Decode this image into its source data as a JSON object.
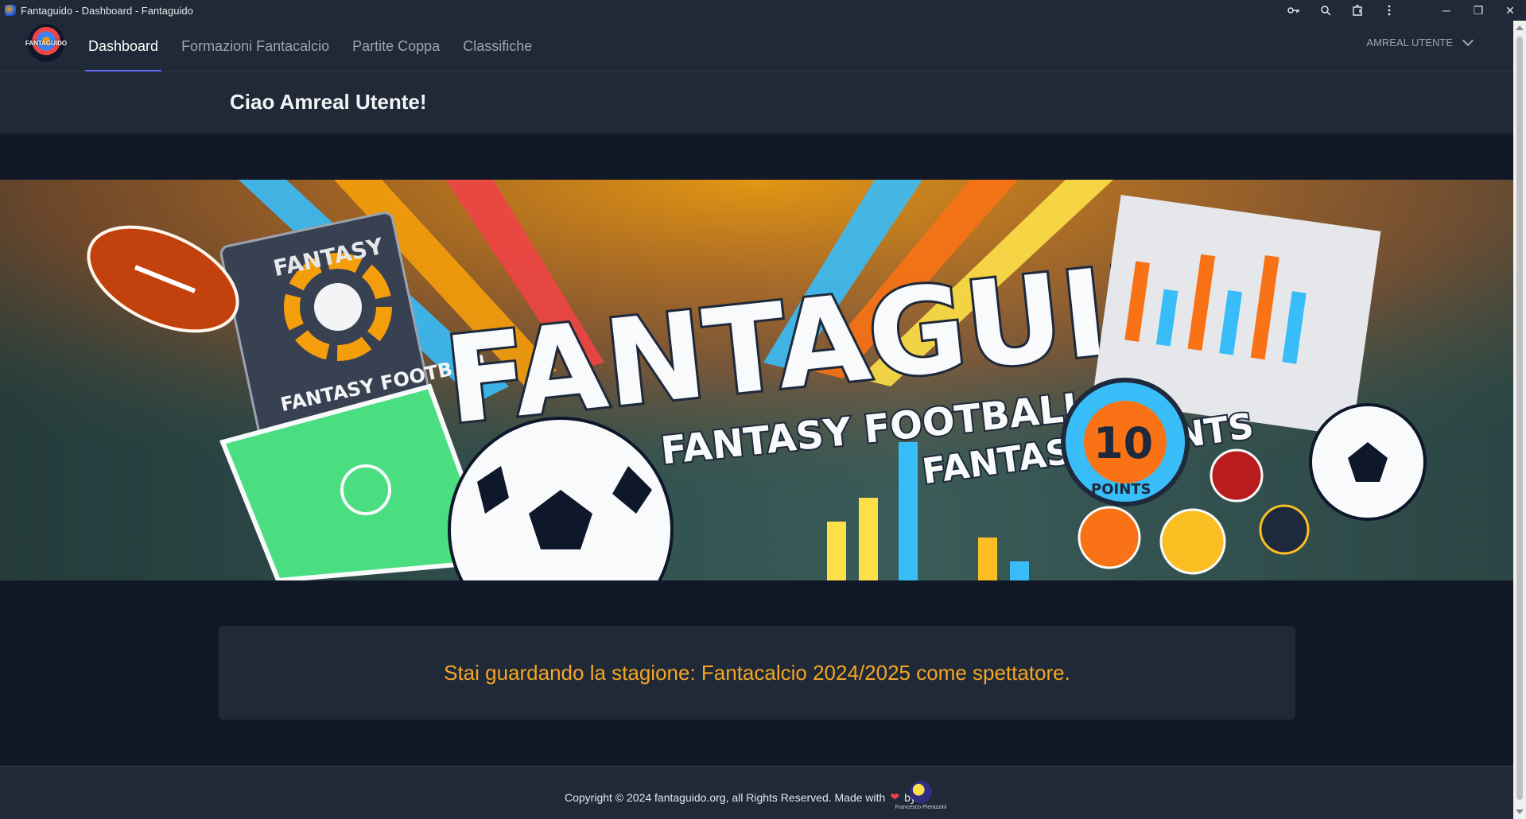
{
  "window": {
    "title": "Fantaguido - Dashboard - Fantaguido"
  },
  "toolbar_icons": [
    "key-icon",
    "zoom-icon",
    "extensions-icon",
    "menu-icon"
  ],
  "window_controls": {
    "minimize": "─",
    "restore": "❐",
    "close": "✕"
  },
  "navbar": {
    "logo_text": "FANTAGUIDO",
    "links": [
      {
        "label": "Dashboard",
        "active": true
      },
      {
        "label": "Formazioni Fantacalcio",
        "active": false
      },
      {
        "label": "Partite Coppa",
        "active": false
      },
      {
        "label": "Classifiche",
        "active": false
      }
    ],
    "user_label": "AMREAL UTENTE"
  },
  "greeting": "Ciao Amreal Utente!",
  "banner": {
    "title": "FANTAGUIDO",
    "subtitle": "FANTASY FOOTBALL",
    "badge_left_top": "FANTASY",
    "badge_left_bottom": "FANTASY FOOTBALL",
    "points_label": "FANTASY POINTS",
    "points_value": "10",
    "points_ring": "POINTS"
  },
  "season_message": "Stai guardando la stagione: Fantacalcio 2024/2025 come spettatore.",
  "footer": {
    "copyright": "Copyright © 2024 fantaguido.org, all Rights Reserved. Made with",
    "by": "by",
    "signature": "Francesco Pierazzini"
  },
  "colors": {
    "background": "#111827",
    "surface": "#1f2937",
    "accent": "#6366f1",
    "season_text": "#f5a623"
  }
}
